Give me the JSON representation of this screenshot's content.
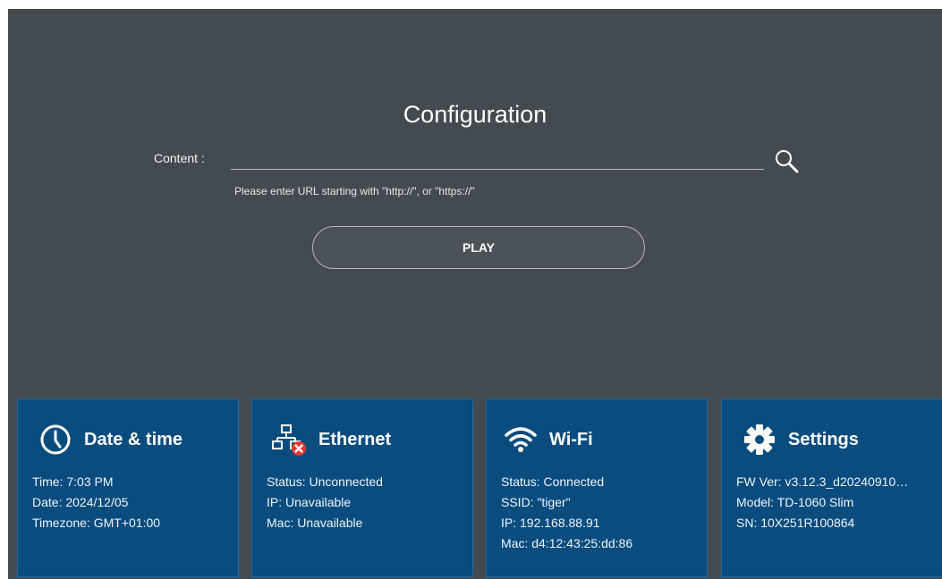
{
  "config": {
    "title": "Configuration",
    "content_label": "Content :",
    "url_value": "",
    "url_placeholder": "",
    "hint": "Please enter URL starting with \"http://\", or \"https://\"",
    "play_label": "PLAY",
    "search_icon": "magnifier-icon"
  },
  "tiles": {
    "datetime": {
      "title": "Date & time",
      "icon": "clock-icon",
      "lines": [
        "Time: 7:03 PM",
        "Date: 2024/12/05",
        "Timezone: GMT+01:00"
      ]
    },
    "ethernet": {
      "title": "Ethernet",
      "icon": "ethernet-disconnected-icon",
      "lines": [
        "Status: Unconnected",
        "IP: Unavailable",
        "Mac: Unavailable"
      ]
    },
    "wifi": {
      "title": "Wi-Fi",
      "icon": "wifi-icon",
      "lines": [
        "Status: Connected",
        "SSID: \"tiger\"",
        "IP: 192.168.88.91",
        "Mac: d4:12:43:25:dd:86"
      ]
    },
    "settings": {
      "title": "Settings",
      "icon": "gear-icon",
      "lines": [
        "FW Ver: v3.12.3_d20240910…",
        "Model: TD-1060 Slim",
        "SN: 10X251R100864"
      ]
    }
  },
  "colors": {
    "background": "#434b51",
    "tile": "#0b4c7e",
    "tile_border": "#1c6aa6",
    "error_badge": "#e23b2e"
  }
}
